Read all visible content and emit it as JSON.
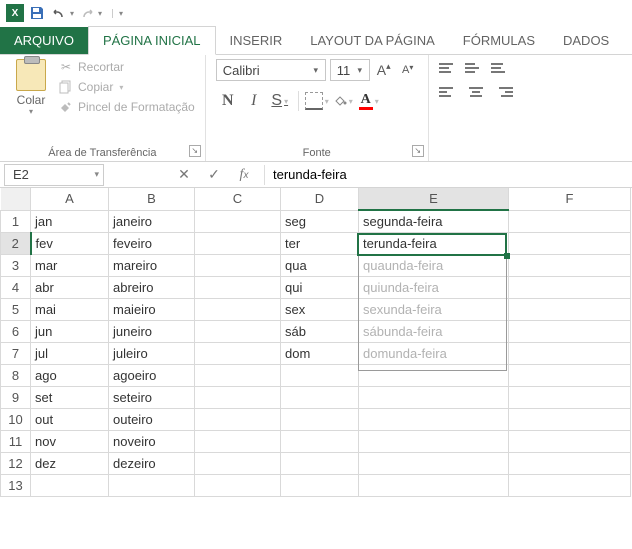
{
  "qat": {
    "app_initial": "X"
  },
  "tabs": {
    "file": "ARQUIVO",
    "home": "PÁGINA INICIAL",
    "insert": "INSERIR",
    "layout": "LAYOUT DA PÁGINA",
    "formulas": "FÓRMULAS",
    "data": "DADOS"
  },
  "ribbon": {
    "clipboard": {
      "paste": "Colar",
      "cut": "Recortar",
      "copy": "Copiar",
      "format_painter": "Pincel de Formatação",
      "group_label": "Área de Transferência"
    },
    "font": {
      "font_name": "Calibri",
      "font_size": "11",
      "bold": "N",
      "italic": "I",
      "underline": "S",
      "font_color_letter": "A",
      "group_label": "Fonte"
    }
  },
  "formula_bar": {
    "name_box": "E2",
    "formula": "terunda-feira"
  },
  "columns": [
    "A",
    "B",
    "C",
    "D",
    "E",
    "F"
  ],
  "rows": [
    {
      "n": "1",
      "a": "jan",
      "b": "janeiro",
      "c": "",
      "d": "seg",
      "e": "segunda-feira",
      "ghost": false
    },
    {
      "n": "2",
      "a": "fev",
      "b": "feveiro",
      "c": "",
      "d": "ter",
      "e": "terunda-feira",
      "ghost": false
    },
    {
      "n": "3",
      "a": "mar",
      "b": "mareiro",
      "c": "",
      "d": "qua",
      "e": "quaunda-feira",
      "ghost": true
    },
    {
      "n": "4",
      "a": "abr",
      "b": "abreiro",
      "c": "",
      "d": "qui",
      "e": "quiunda-feira",
      "ghost": true
    },
    {
      "n": "5",
      "a": "mai",
      "b": "maieiro",
      "c": "",
      "d": "sex",
      "e": "sexunda-feira",
      "ghost": true
    },
    {
      "n": "6",
      "a": "jun",
      "b": "juneiro",
      "c": "",
      "d": "sáb",
      "e": "sábunda-feira",
      "ghost": true
    },
    {
      "n": "7",
      "a": "jul",
      "b": "juleiro",
      "c": "",
      "d": "dom",
      "e": "domunda-feira",
      "ghost": true
    },
    {
      "n": "8",
      "a": "ago",
      "b": "agoeiro",
      "c": "",
      "d": "",
      "e": "",
      "ghost": false
    },
    {
      "n": "9",
      "a": "set",
      "b": "seteiro",
      "c": "",
      "d": "",
      "e": "",
      "ghost": false
    },
    {
      "n": "10",
      "a": "out",
      "b": "outeiro",
      "c": "",
      "d": "",
      "e": "",
      "ghost": false
    },
    {
      "n": "11",
      "a": "nov",
      "b": "noveiro",
      "c": "",
      "d": "",
      "e": "",
      "ghost": false
    },
    {
      "n": "12",
      "a": "dez",
      "b": "dezeiro",
      "c": "",
      "d": "",
      "e": "",
      "ghost": false
    },
    {
      "n": "13",
      "a": "",
      "b": "",
      "c": "",
      "d": "",
      "e": "",
      "ghost": false
    }
  ],
  "selection": {
    "col": "E",
    "row": 2
  },
  "autofill_range": {
    "col": "E",
    "from_row": 2,
    "to_row": 7
  }
}
